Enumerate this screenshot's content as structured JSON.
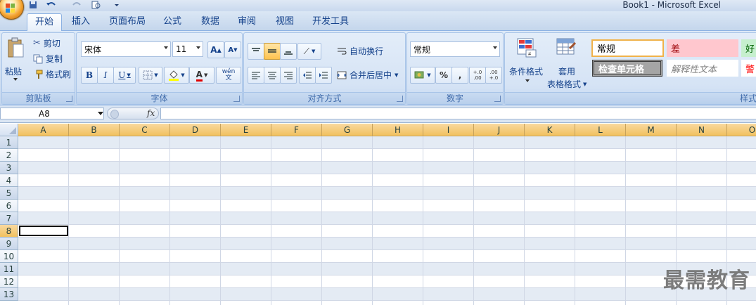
{
  "window": {
    "title": "Book1 - Microsoft Excel",
    "quick_access": [
      "save-icon",
      "undo-icon",
      "redo-icon",
      "print-preview-icon",
      "customize-icon"
    ]
  },
  "tabs": [
    {
      "label": "开始",
      "active": true
    },
    {
      "label": "插入",
      "active": false
    },
    {
      "label": "页面布局",
      "active": false
    },
    {
      "label": "公式",
      "active": false
    },
    {
      "label": "数据",
      "active": false
    },
    {
      "label": "审阅",
      "active": false
    },
    {
      "label": "视图",
      "active": false
    },
    {
      "label": "开发工具",
      "active": false
    }
  ],
  "clipboard": {
    "group_label": "剪贴板",
    "paste": "粘贴",
    "cut": "剪切",
    "copy": "复制",
    "format_painter": "格式刷"
  },
  "font": {
    "group_label": "字体",
    "font_name": "宋体",
    "font_size": "11",
    "bold": "B",
    "italic": "I",
    "underline": "U",
    "grow": "A",
    "shrink": "A",
    "font_color": "A",
    "phonetic": "wén 文"
  },
  "alignment": {
    "group_label": "对齐方式",
    "wrap_text": "自动换行",
    "merge_center": "合并后居中"
  },
  "number": {
    "group_label": "数字",
    "format": "常规",
    "percent": "%",
    "comma": ",",
    "inc_decimal": "+.0 .00",
    "dec_decimal": ".00 +.0"
  },
  "styles": {
    "group_label": "样式",
    "conditional_format": "条件格式",
    "format_as_table_1": "套用",
    "format_as_table_2": "表格格式",
    "normal": "常规",
    "bad": "差",
    "good": "好",
    "check_cell": "检查单元格",
    "explanatory": "解释性文本",
    "warning": "警"
  },
  "formula_bar": {
    "name_box": "A8",
    "fx": "fx"
  },
  "grid": {
    "columns": [
      "A",
      "B",
      "C",
      "D",
      "E",
      "F",
      "G",
      "H",
      "I",
      "J",
      "K",
      "L",
      "M",
      "N",
      "O"
    ],
    "rows": [
      "1",
      "2",
      "3",
      "4",
      "5",
      "6",
      "7",
      "8",
      "9",
      "10",
      "11",
      "12",
      "13"
    ],
    "active_cell": "A8"
  },
  "watermark": "最需教育",
  "colors": {
    "ribbon_blue": "#d0e0f3",
    "header_orange": "#f1c15f",
    "text_blue": "#15428b",
    "bad_fill": "#ffc7ce",
    "good_fill": "#c6efce",
    "check_fill": "#a5a5a5"
  }
}
